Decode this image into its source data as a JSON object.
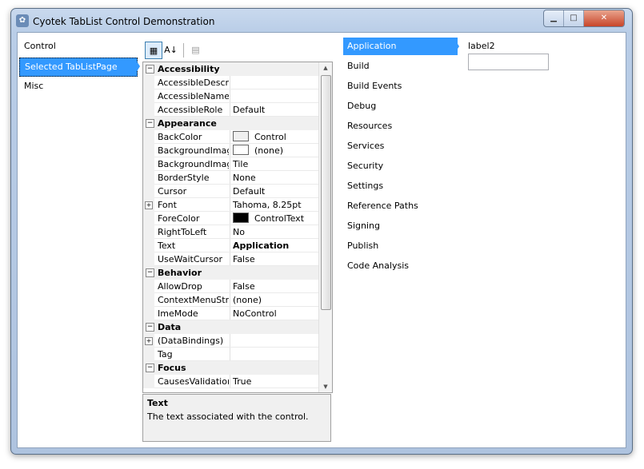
{
  "window": {
    "title": "Cyotek TabList Control Demonstration",
    "buttons": {
      "minimize": "▁",
      "maximize": "□",
      "close": "✕"
    }
  },
  "nav": {
    "items": [
      {
        "label": "Control",
        "selected": false
      },
      {
        "label": "Selected TabListPage",
        "selected": true
      },
      {
        "label": "Misc",
        "selected": false
      }
    ]
  },
  "toolbar": {
    "categorized": "▦",
    "alphabetical": "A↓",
    "pages": "▤"
  },
  "property_grid": {
    "rows": [
      {
        "type": "category",
        "label": "Accessibility"
      },
      {
        "type": "prop",
        "name": "AccessibleDescripti",
        "value": ""
      },
      {
        "type": "prop",
        "name": "AccessibleName",
        "value": ""
      },
      {
        "type": "prop",
        "name": "AccessibleRole",
        "value": "Default"
      },
      {
        "type": "category",
        "label": "Appearance"
      },
      {
        "type": "prop",
        "name": "BackColor",
        "value": "Control",
        "swatch": "#f0f0f0"
      },
      {
        "type": "prop",
        "name": "BackgroundImage",
        "value": "(none)",
        "swatch": "#ffffff"
      },
      {
        "type": "prop",
        "name": "BackgroundImageL",
        "value": "Tile"
      },
      {
        "type": "prop",
        "name": "BorderStyle",
        "value": "None"
      },
      {
        "type": "prop",
        "name": "Cursor",
        "value": "Default"
      },
      {
        "type": "prop",
        "name": "Font",
        "value": "Tahoma, 8.25pt",
        "expandable": true
      },
      {
        "type": "prop",
        "name": "ForeColor",
        "value": "ControlText",
        "swatch": "#000000"
      },
      {
        "type": "prop",
        "name": "RightToLeft",
        "value": "No"
      },
      {
        "type": "prop",
        "name": "Text",
        "value": "Application",
        "bold": true
      },
      {
        "type": "prop",
        "name": "UseWaitCursor",
        "value": "False"
      },
      {
        "type": "category",
        "label": "Behavior"
      },
      {
        "type": "prop",
        "name": "AllowDrop",
        "value": "False"
      },
      {
        "type": "prop",
        "name": "ContextMenuStrip",
        "value": "(none)"
      },
      {
        "type": "prop",
        "name": "ImeMode",
        "value": "NoControl"
      },
      {
        "type": "category",
        "label": "Data"
      },
      {
        "type": "prop",
        "name": "(DataBindings)",
        "value": "",
        "expandable": true
      },
      {
        "type": "prop",
        "name": "Tag",
        "value": ""
      },
      {
        "type": "category",
        "label": "Focus"
      },
      {
        "type": "prop",
        "name": "CausesValidation",
        "value": "True"
      }
    ],
    "description": {
      "title": "Text",
      "text": "The text associated with the control."
    }
  },
  "tablist": {
    "tabs": [
      {
        "label": "Application",
        "selected": true
      },
      {
        "label": "Build",
        "selected": false
      },
      {
        "label": "Build Events",
        "selected": false
      },
      {
        "label": "Debug",
        "selected": false
      },
      {
        "label": "Resources",
        "selected": false
      },
      {
        "label": "Services",
        "selected": false
      },
      {
        "label": "Security",
        "selected": false
      },
      {
        "label": "Settings",
        "selected": false
      },
      {
        "label": "Reference Paths",
        "selected": false
      },
      {
        "label": "Signing",
        "selected": false
      },
      {
        "label": "Publish",
        "selected": false
      },
      {
        "label": "Code Analysis",
        "selected": false
      }
    ],
    "page": {
      "label": "label2",
      "textbox_value": ""
    }
  },
  "colors": {
    "selection": "#3399ff",
    "category_bg": "#f0f0f0"
  }
}
